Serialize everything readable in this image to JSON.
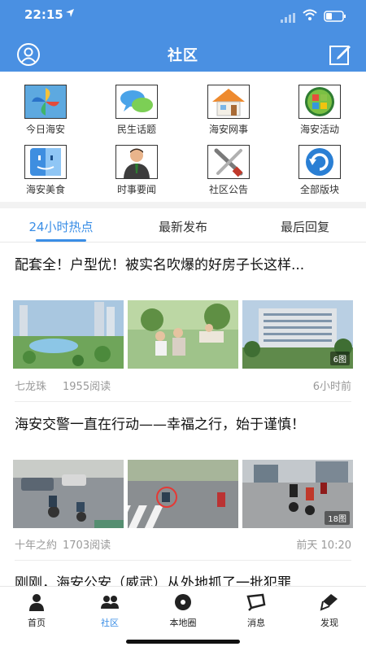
{
  "status_bar": {
    "time": "22:15",
    "location_icon": "location-arrow-icon",
    "signal_icon": "cellular-signal-icon",
    "wifi_icon": "wifi-icon",
    "battery_icon": "battery-icon"
  },
  "header": {
    "title": "社区",
    "avatar_icon": "user-avatar-icon",
    "compose_icon": "compose-edit-icon",
    "background": "#4a90e2"
  },
  "forums": [
    {
      "label": "今日海安",
      "icon": "pinwheel-icon"
    },
    {
      "label": "民生话题",
      "icon": "chat-bubbles-icon"
    },
    {
      "label": "海安网事",
      "icon": "house-icon"
    },
    {
      "label": "海安活动",
      "icon": "windows-orb-icon"
    },
    {
      "label": "海安美食",
      "icon": "finder-face-icon"
    },
    {
      "label": "时事要闻",
      "icon": "businessman-icon"
    },
    {
      "label": "社区公告",
      "icon": "tools-icon"
    },
    {
      "label": "全部版块",
      "icon": "refresh-icon"
    }
  ],
  "tabs": [
    {
      "label": "24小时热点",
      "active": true
    },
    {
      "label": "最新发布",
      "active": false
    },
    {
      "label": "最后回复",
      "active": false
    }
  ],
  "accent": "#3a8ee6",
  "posts": [
    {
      "title": "配套全！户型优！被实名吹爆的好房子长这样...",
      "images": [
        "city-park-rendering",
        "family-picnic-photo",
        "apartment-buildings-rendering"
      ],
      "image_count_badge": "6图",
      "author": "七龙珠",
      "reads": "1955阅读",
      "time": "6小时前"
    },
    {
      "title": "海安交警一直在行动——幸福之行，始于谨慎！",
      "images": [
        "traffic-intersection-photo",
        "crosswalk-photo",
        "road-motorcycles-photo"
      ],
      "image_count_badge": "18图",
      "author": "十年之約",
      "reads": "1703阅读",
      "time": "前天 10:20"
    },
    {
      "title": "刚刚，海安公安（威武）从外地抓了一批犯罪"
    }
  ],
  "bottom_nav": [
    {
      "label": "首页",
      "icon": "person-icon",
      "active": false
    },
    {
      "label": "社区",
      "icon": "people-group-icon",
      "active": true
    },
    {
      "label": "本地圈",
      "icon": "disc-icon",
      "active": false
    },
    {
      "label": "消息",
      "icon": "message-flag-icon",
      "active": false
    },
    {
      "label": "发现",
      "icon": "discover-pen-icon",
      "active": false
    }
  ]
}
